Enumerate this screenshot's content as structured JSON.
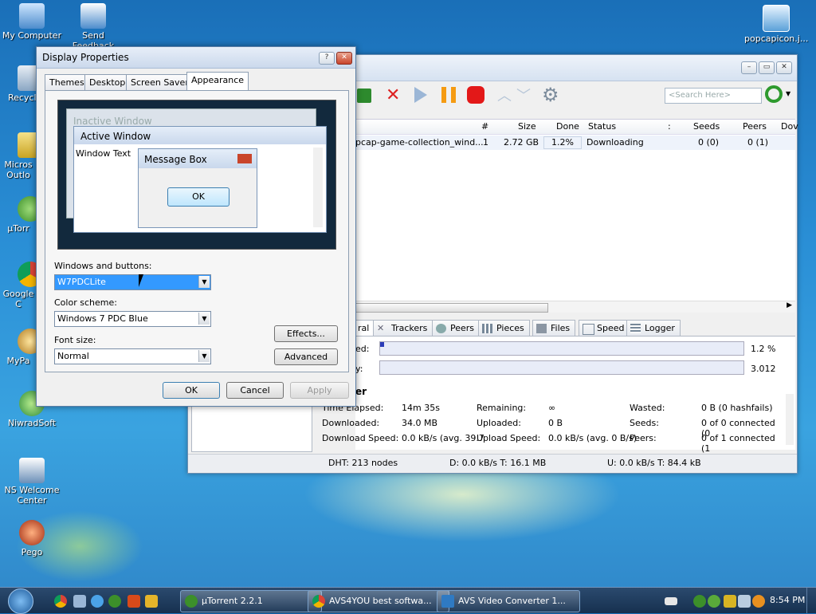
{
  "desktop": {
    "icons": [
      {
        "label": "My Computer"
      },
      {
        "label": "Send Feedback"
      },
      {
        "label": "popcapicon.j..."
      },
      {
        "label": "Recycl"
      },
      {
        "label": "Micros Outlo"
      },
      {
        "label": "µTorr"
      },
      {
        "label": "Google C"
      },
      {
        "label": "MyPa"
      },
      {
        "label": "NiwradSoft"
      },
      {
        "label": "NS Welcome Center"
      },
      {
        "label": "Pego"
      }
    ]
  },
  "utorrent": {
    "search_placeholder": "<Search Here>",
    "columns": [
      "#",
      "Size",
      "Done",
      "Status",
      ":",
      "Seeds",
      "Peers",
      "Dov"
    ],
    "row": {
      "name": "pcap-game-collection_wind...",
      "num": "1",
      "size": "2.72 GB",
      "done": "1.2%",
      "status": "Downloading",
      "seeds": "0 (0)",
      "peers": "0 (1)"
    },
    "tabs": [
      "ral",
      "Trackers",
      "Peers",
      "Pieces",
      "Files",
      "Speed",
      "Logger"
    ],
    "bars": {
      "downloaded_label": "ed:",
      "downloaded_value": "1.2 %",
      "availability_label": "y:",
      "availability_value": "3.012"
    },
    "transfer_title": "er",
    "info": {
      "time_elapsed_label": "Time Elapsed:",
      "time_elapsed": "14m 35s",
      "remaining_label": "Remaining:",
      "remaining": "∞",
      "wasted_label": "Wasted:",
      "wasted": "0 B (0 hashfails)",
      "downloaded_label": "Downloaded:",
      "downloaded": "34.0 MB",
      "uploaded_label": "Uploaded:",
      "uploaded": "0 B",
      "seeds_label": "Seeds:",
      "seeds": "0 of 0 connected (0",
      "dl_speed_label": "Download Speed:",
      "dl_speed": "0.0 kB/s (avg. 39.7",
      "ul_speed_label": "Upload Speed:",
      "ul_speed": "0.0 kB/s (avg. 0 B/s)",
      "peers_label": "Peers:",
      "peers": "0 of 1 connected (1"
    },
    "status": {
      "dht": "DHT: 213 nodes",
      "down": "D: 0.0 kB/s T: 16.1 MB",
      "up": "U: 0.0 kB/s T: 84.4 kB"
    }
  },
  "display_properties": {
    "title": "Display Properties",
    "tabs": [
      "Themes",
      "Desktop",
      "Screen Saver",
      "Appearance"
    ],
    "preview": {
      "inactive": "Inactive Window",
      "active": "Active Window",
      "window_text": "Window Text",
      "message_box": "Message Box",
      "ok": "OK"
    },
    "windows_buttons_label": "Windows and buttons:",
    "windows_buttons_value": "W7PDCLite",
    "color_scheme_label": "Color scheme:",
    "color_scheme_value": "Windows 7 PDC Blue",
    "font_size_label": "Font size:",
    "font_size_value": "Normal",
    "effects": "Effects...",
    "advanced": "Advanced",
    "ok": "OK",
    "cancel": "Cancel",
    "apply": "Apply"
  },
  "taskbar": {
    "items": [
      {
        "label": "µTorrent 2.2.1"
      },
      {
        "label": "AVS4YOU best softwa..."
      },
      {
        "label": "AVS Video Converter 1..."
      }
    ],
    "clock": "8:54 PM"
  },
  "colors": {
    "accent": "#3399ff",
    "close_red": "#c9452b",
    "taskbar": "#1f3a5c"
  }
}
